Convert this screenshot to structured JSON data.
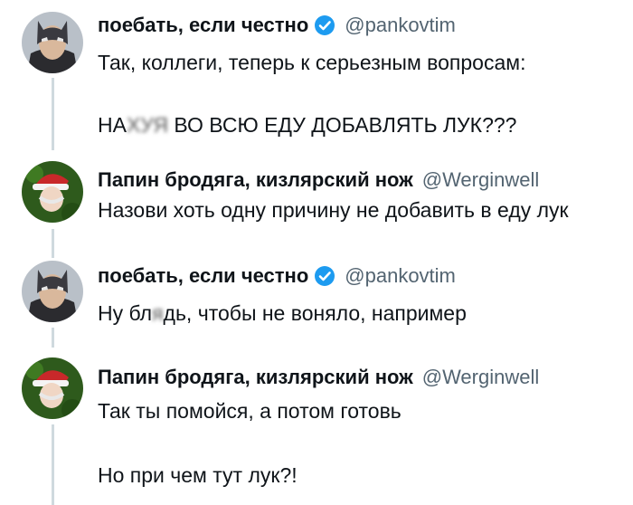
{
  "thread": [
    {
      "author": {
        "name": "поебать, если честно",
        "handle": "@pankovtim",
        "verified": true,
        "avatar": "batman-avatar"
      },
      "lines": {
        "l1": "Так, коллеги, теперь к серьезным вопросам:",
        "l2_pre": "НА",
        "l2_mask": "ХУЯ",
        "l2_post": " ВО ВСЮ ЕДУ ДОБАВЛЯТЬ ЛУК???"
      }
    },
    {
      "author": {
        "name": "Папин бродяга, кизлярский нож",
        "handle": "@Werginwell",
        "verified": false,
        "avatar": "santa-hat-avatar"
      },
      "lines": {
        "l1": "Назови хоть одну причину не добавить в еду лук"
      }
    },
    {
      "author": {
        "name": "поебать, если честно",
        "handle": "@pankovtim",
        "verified": true,
        "avatar": "batman-avatar"
      },
      "lines": {
        "l1_pre": "Ну бл",
        "l1_mask": "я",
        "l1_post": "дь, чтобы не воняло, например"
      }
    },
    {
      "author": {
        "name": "Папин бродяга, кизлярский нож",
        "handle": "@Werginwell",
        "verified": false,
        "avatar": "santa-hat-avatar"
      },
      "lines": {
        "l1": "Так ты помойся, а потом готовь",
        "l2": "Но при чем тут лук?!"
      }
    }
  ],
  "colors": {
    "text": "#0f1419",
    "secondary": "#536471",
    "verified": "#1d9bf0",
    "connector": "#cfd9de"
  }
}
